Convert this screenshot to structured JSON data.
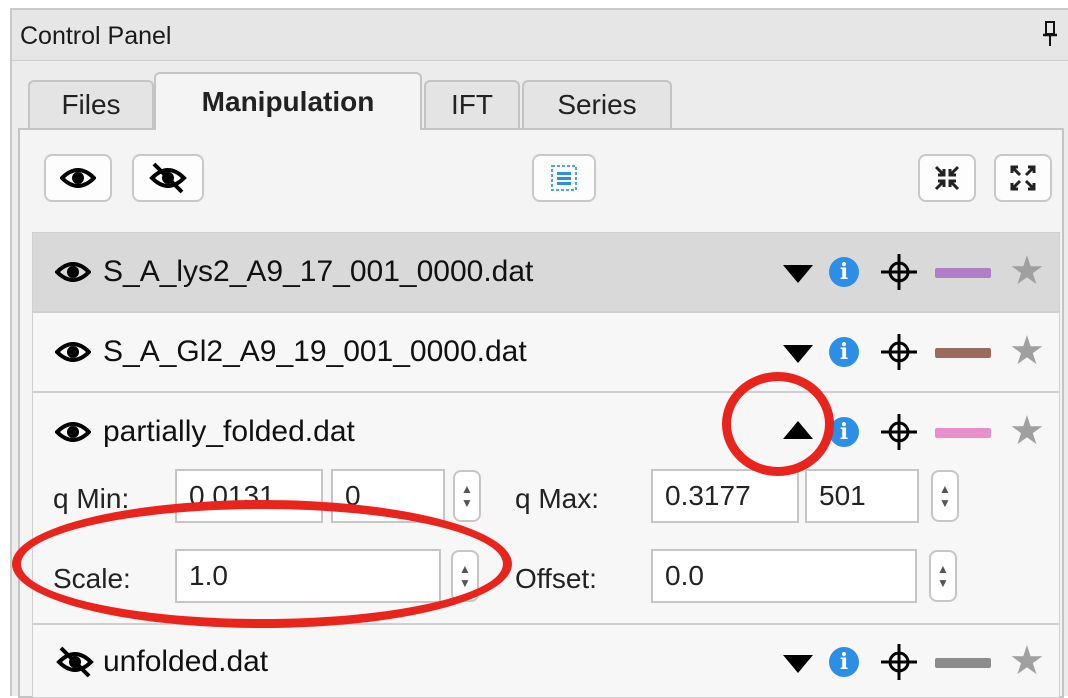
{
  "panel": {
    "title": "Control Panel"
  },
  "tabs": [
    {
      "label": "Files",
      "active": false
    },
    {
      "label": "Manipulation",
      "active": true
    },
    {
      "label": "IFT",
      "active": false
    },
    {
      "label": "Series",
      "active": false
    }
  ],
  "toolbar": {
    "icons": [
      "eye-icon",
      "eye-slash-icon",
      "list-select-icon",
      "collapse-all-icon",
      "expand-all-icon"
    ]
  },
  "files": [
    {
      "name": "S_A_lys2_A9_17_001_0000.dat",
      "visible": true,
      "selected": true,
      "expanded": false,
      "color": "#b07ec9"
    },
    {
      "name": "S_A_Gl2_A9_19_001_0000.dat",
      "visible": true,
      "selected": false,
      "expanded": false,
      "color": "#9c6b60"
    },
    {
      "name": "partially_folded.dat",
      "visible": true,
      "selected": false,
      "expanded": true,
      "color": "#e88fcc",
      "controls": {
        "q_min_label": "q Min:",
        "q_min_value": "0.0131",
        "q_min_index": "0",
        "q_max_label": "q Max:",
        "q_max_value": "0.3177",
        "q_max_index": "501",
        "scale_label": "Scale:",
        "scale_value": "1.0",
        "offset_label": "Offset:",
        "offset_value": "0.0"
      }
    },
    {
      "name": "unfolded.dat",
      "visible": false,
      "selected": false,
      "expanded": false,
      "color": "#8c8c8c"
    }
  ],
  "annotation_color": "#e8241c"
}
